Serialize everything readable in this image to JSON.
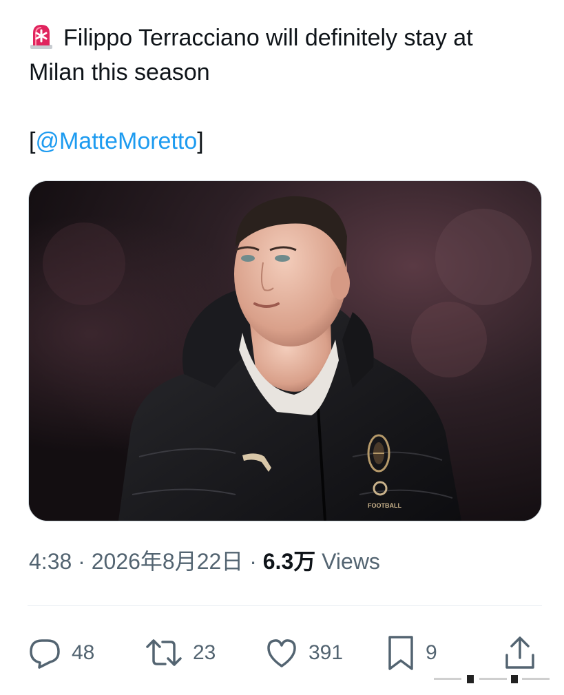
{
  "tweet": {
    "headline_line1": "Filippo Terracciano will definitely stay at",
    "headline_line2": "Milan this season",
    "mention_prefix": "[",
    "mention_handle": "@MatteMoretto",
    "mention_suffix": "]"
  },
  "media": {
    "jacket_logo_text": "FOOTBALL"
  },
  "meta": {
    "time": "4:38",
    "separator": " · ",
    "date": "2026年8月22日",
    "views_count": "6.3万",
    "views_label": "Views"
  },
  "actions": {
    "replies": "48",
    "retweets": "23",
    "likes": "391",
    "bookmarks": "9"
  },
  "colors": {
    "text": "#0f1419",
    "secondary": "#536471",
    "link": "#1d9bf0",
    "alert": "#e0245e"
  },
  "icons": {
    "alert": "rotating-light-icon",
    "reply": "reply-icon",
    "retweet": "retweet-icon",
    "like": "heart-icon",
    "bookmark": "bookmark-icon",
    "share": "share-icon"
  }
}
